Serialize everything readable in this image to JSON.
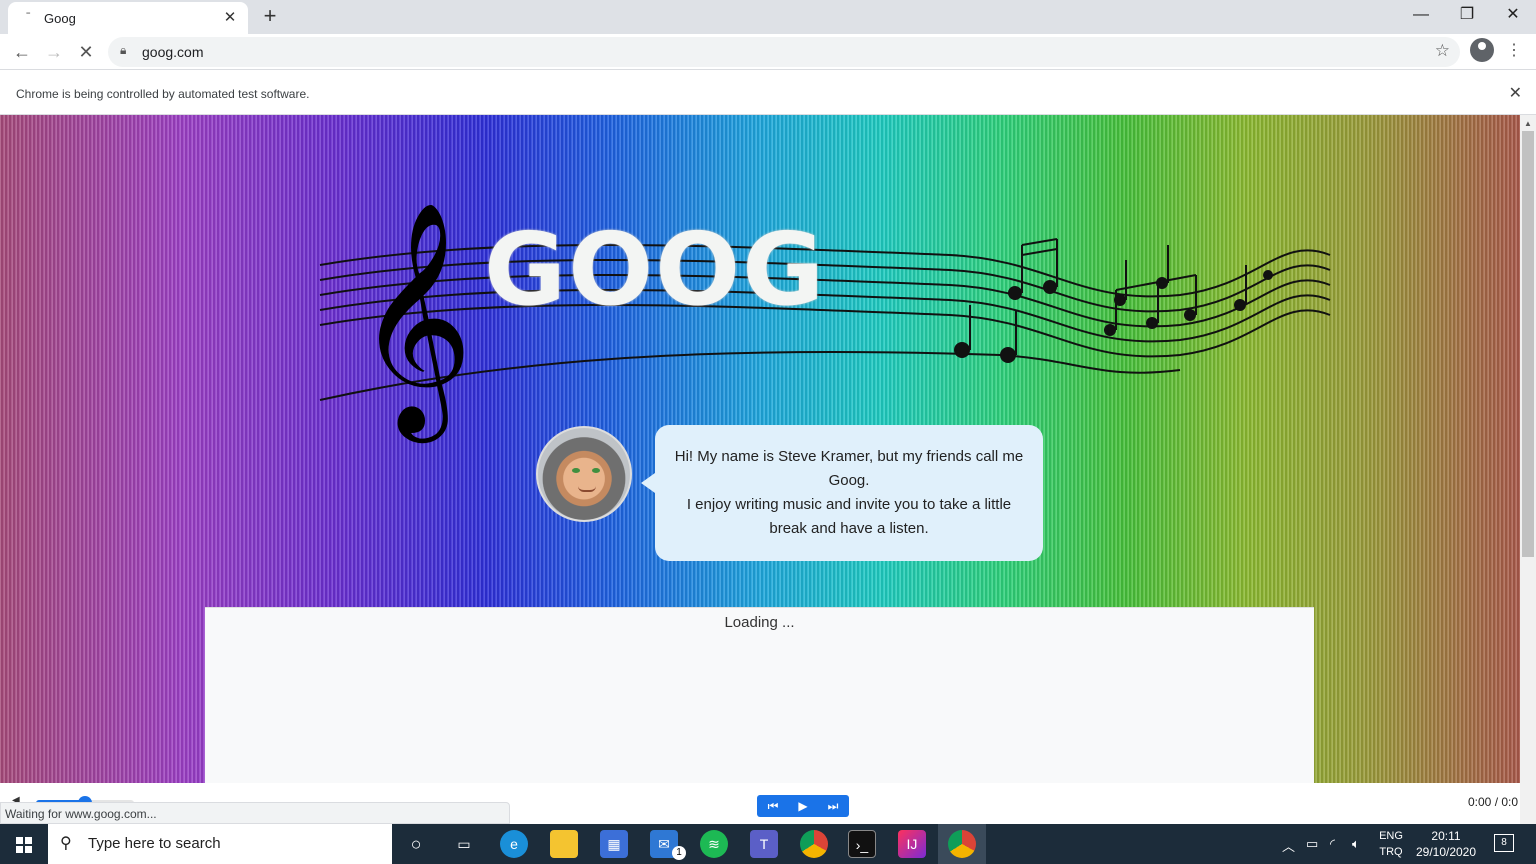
{
  "browser": {
    "tab_title": "Goog",
    "url": "goog.com",
    "infobar_message": "Chrome is being controlled by automated test software."
  },
  "page": {
    "logo_text": "GOOG",
    "speech_line1": "Hi! My name is Steve Kramer, but my friends call me Goog.",
    "speech_line2": "I enjoy writing music and invite you to take a little break and have a listen.",
    "loading_text": "Loading ..."
  },
  "player": {
    "volume_percent": 50,
    "time": "0:00 / 0:0",
    "status_text": "Waiting for www.goog.com..."
  },
  "taskbar": {
    "search_placeholder": "Type here to search",
    "lang_top": "ENG",
    "lang_bottom": "TRQ",
    "time": "20:11",
    "date": "29/10/2020",
    "mail_badge": "1",
    "notification_count": "8"
  },
  "icons": [
    "windows-start-icon",
    "search-icon",
    "cortana-icon",
    "task-view-icon",
    "edge-icon",
    "file-explorer-icon",
    "store-icon",
    "mail-icon",
    "spotify-icon",
    "teams-icon",
    "chrome-icon",
    "terminal-icon",
    "intellij-icon"
  ]
}
